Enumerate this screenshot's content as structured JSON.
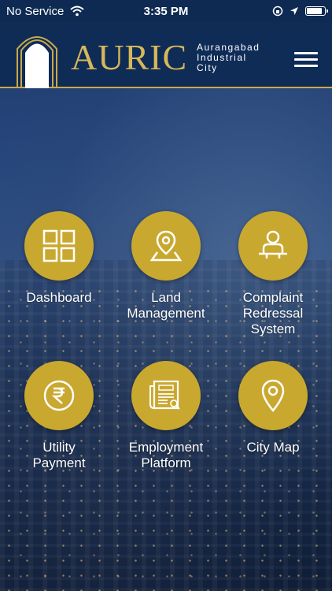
{
  "status_bar": {
    "carrier": "No Service",
    "time": "3:35 PM"
  },
  "header": {
    "brand": "AURIC",
    "subtitle_line1": "Aurangabad",
    "subtitle_line2": "Industrial",
    "subtitle_line3": "City",
    "accent_color": "#c9a94a"
  },
  "tiles": [
    {
      "label": "Dashboard",
      "icon": "grid-icon"
    },
    {
      "label": "Land\nManagement",
      "icon": "map-pin-icon"
    },
    {
      "label": "Complaint\nRedressal\nSystem",
      "icon": "user-desk-icon"
    },
    {
      "label": "Utility\nPayment",
      "icon": "rupee-icon"
    },
    {
      "label": "Employment\nPlatform",
      "icon": "newspaper-jobs-icon"
    },
    {
      "label": "City Map",
      "icon": "location-pin-icon"
    }
  ]
}
